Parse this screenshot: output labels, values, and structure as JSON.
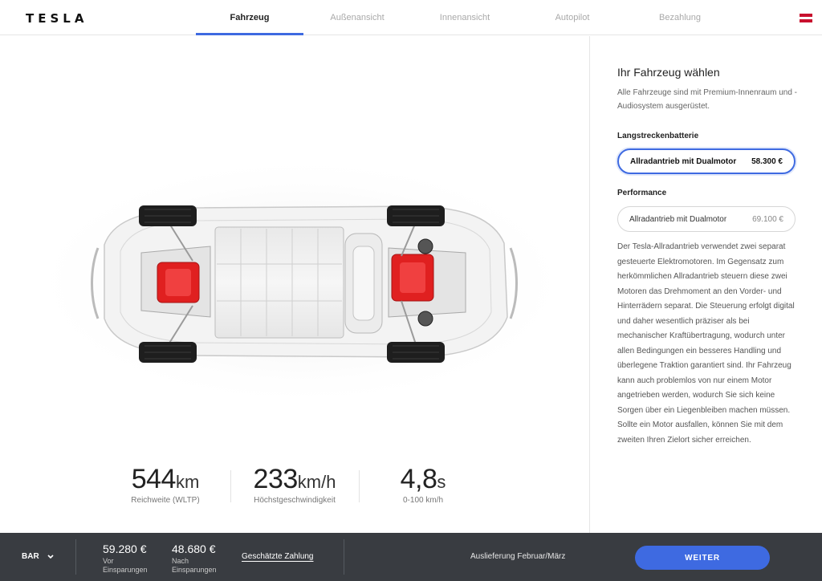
{
  "brand": {
    "logo": "TESLA"
  },
  "nav": {
    "tabs": [
      {
        "label": "Fahrzeug",
        "active": true
      },
      {
        "label": "Außenansicht",
        "active": false
      },
      {
        "label": "Innenansicht",
        "active": false
      },
      {
        "label": "Autopilot",
        "active": false
      },
      {
        "label": "Bezahlung",
        "active": false
      }
    ],
    "flag_colors": [
      "#c8102e",
      "#ffffff",
      "#c8102e"
    ]
  },
  "specs": [
    {
      "value": "544",
      "unit": "km",
      "label": "Reichweite (WLTP)"
    },
    {
      "value": "233",
      "unit": "km/h",
      "label": "Höchstgeschwindigkeit"
    },
    {
      "value": "4,8",
      "unit": "s",
      "label": "0-100 km/h"
    }
  ],
  "panel": {
    "title": "Ihr Fahrzeug wählen",
    "subtitle": "Alle Fahrzeuge sind mit Premium-Innenraum und -Audiosystem ausgerüstet.",
    "groups": [
      {
        "label": "Langstreckenbatterie",
        "option": {
          "name": "Allradantrieb mit Dualmotor",
          "price": "58.300 €",
          "selected": true
        }
      },
      {
        "label": "Performance",
        "option": {
          "name": "Allradantrieb mit Dualmotor",
          "price": "69.100 €",
          "selected": false
        }
      }
    ],
    "description": "Der Tesla-Allradantrieb verwendet zwei separat gesteuerte Elektromotoren. Im Gegensatz zum herkömmlichen Allradantrieb steuern diese zwei Motoren das Drehmoment an den Vorder- und Hinterrädern separat. Die Steuerung erfolgt digital und daher wesentlich präziser als bei mechanischer Kraftübertragung, wodurch unter allen Bedingungen ein besseres Handling und überlegene Traktion garantiert sind. Ihr Fahrzeug kann auch problemlos von nur einem Motor angetrieben werden, wodurch Sie sich keine Sorgen über ein Liegenbleiben machen müssen. Sollte ein Motor ausfallen, können Sie mit dem zweiten Ihren Zielort sicher erreichen."
  },
  "footer": {
    "payment_type": "BAR",
    "price_before": "59.280 €",
    "price_before_caption": "Vor Einsparungen",
    "price_after": "48.680 €",
    "price_after_caption": "Nach Einsparungen",
    "estimate_link": "Geschätzte Zahlung",
    "delivery": "Auslieferung Februar/März",
    "next_button": "WEITER"
  },
  "colors": {
    "accent": "#3e6ae1",
    "footer_bg": "#393c41",
    "motor_red": "#e02020"
  }
}
